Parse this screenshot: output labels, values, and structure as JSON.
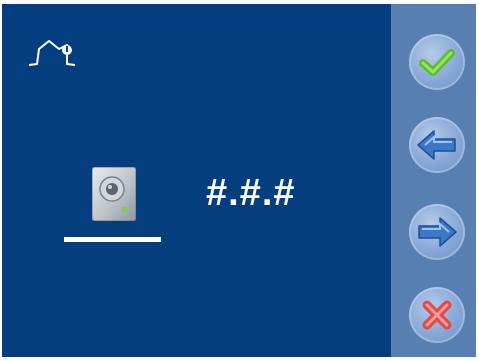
{
  "display": {
    "code_value": "#.#.#"
  },
  "icons": {
    "home": "home-settings-icon",
    "device": "door-entry-panel-icon",
    "confirm": "checkmark-icon",
    "back": "arrow-left-icon",
    "forward": "arrow-right-icon",
    "cancel": "x-cross-icon"
  },
  "colors": {
    "screen_background": "#053e7e",
    "sidebar_background": "#577fb1",
    "confirm_green": "#5bbf2a",
    "cancel_red": "#e04a4a",
    "arrow_blue": "#3b78c8"
  }
}
